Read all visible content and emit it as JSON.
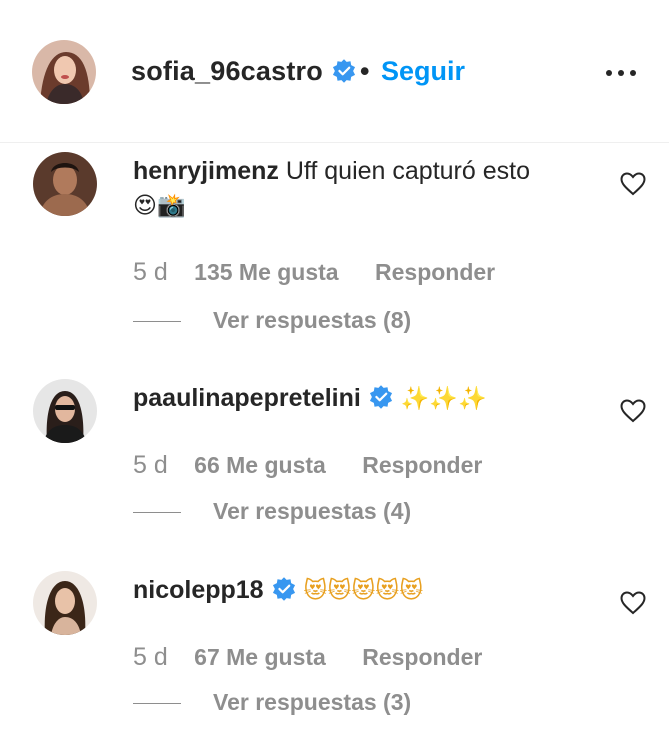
{
  "header": {
    "username": "sofia_96castro",
    "separator": "•",
    "follow_label": "Seguir",
    "more_icon": "more-horizontal-icon"
  },
  "colors": {
    "accent": "#0095f6",
    "text": "#262626",
    "muted": "#8e8e8e"
  },
  "comments": [
    {
      "username": "henryjimenz",
      "verified": false,
      "text_line1": "Uff quien capturó esto",
      "emoji": "😍📸",
      "time": "5 d",
      "likes": "135 Me gusta",
      "reply_label": "Responder",
      "view_replies": "Ver respuestas (8)"
    },
    {
      "username": "paaulinapepretelini",
      "verified": true,
      "emoji": "✨✨✨",
      "time": "5 d",
      "likes": "66 Me gusta",
      "reply_label": "Responder",
      "view_replies": "Ver respuestas (4)"
    },
    {
      "username": "nicolepp18",
      "verified": true,
      "emoji": "😻😻😻😻😻",
      "time": "5 d",
      "likes": "67 Me gusta",
      "reply_label": "Responder",
      "view_replies": "Ver respuestas (3)"
    }
  ]
}
